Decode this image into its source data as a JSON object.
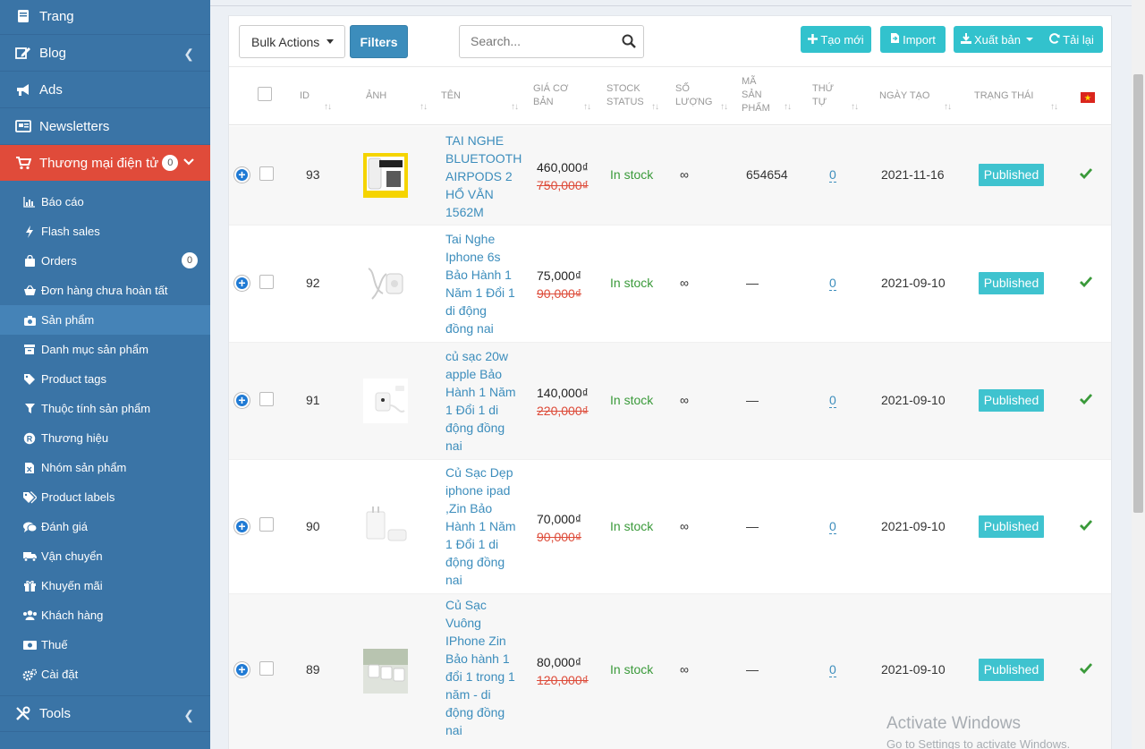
{
  "sidebar": {
    "top_items": [
      {
        "label": "Trang",
        "icon": "book-icon"
      },
      {
        "label": "Blog",
        "icon": "edit-icon",
        "has_chevron": true
      },
      {
        "label": "Ads",
        "icon": "bullhorn-icon"
      },
      {
        "label": "Newsletters",
        "icon": "newspaper-icon"
      }
    ],
    "active_item": {
      "label": "Thương mại điện tử",
      "badge": "0",
      "icon": "cart-icon"
    },
    "sub_items": [
      {
        "label": "Báo cáo",
        "icon": "bar-chart-icon"
      },
      {
        "label": "Flash sales",
        "icon": "bolt-icon"
      },
      {
        "label": "Orders",
        "icon": "shopping-bag-icon",
        "badge": "0"
      },
      {
        "label": "Đơn hàng chưa hoàn tất",
        "icon": "basket-icon"
      },
      {
        "label": "Sản phẩm",
        "icon": "camera-icon",
        "active": true
      },
      {
        "label": "Danh mục sản phẩm",
        "icon": "archive-icon"
      },
      {
        "label": "Product tags",
        "icon": "tag-icon"
      },
      {
        "label": "Thuộc tính sản phẩm",
        "icon": "filter-icon"
      },
      {
        "label": "Thương hiệu",
        "icon": "registered-icon"
      },
      {
        "label": "Nhóm sản phẩm",
        "icon": "excel-file-icon"
      },
      {
        "label": "Product labels",
        "icon": "tags-icon"
      },
      {
        "label": "Đánh giá",
        "icon": "comments-icon"
      },
      {
        "label": "Vận chuyển",
        "icon": "truck-icon"
      },
      {
        "label": "Khuyến mãi",
        "icon": "gift-icon"
      },
      {
        "label": "Khách hàng",
        "icon": "users-icon"
      },
      {
        "label": "Thuế",
        "icon": "money-icon"
      },
      {
        "label": "Cài đặt",
        "icon": "cogs-icon"
      }
    ],
    "bottom_item": {
      "label": "Tools",
      "icon": "tools-icon"
    }
  },
  "toolbar": {
    "bulk_actions": "Bulk Actions",
    "filters": "Filters",
    "search_placeholder": "Search...",
    "create": "Tạo mới",
    "import": "Import",
    "export": "Xuất bản",
    "reload": "Tải lại"
  },
  "table": {
    "headers": {
      "id": "ID",
      "image": "ẢNH",
      "name": "TÊN",
      "base_price": [
        "GIÁ CƠ",
        "BẢN"
      ],
      "stock_status": [
        "STOCK",
        "STATUS"
      ],
      "quantity": [
        "SỐ",
        "LƯỢNG"
      ],
      "sku": [
        "MÃ",
        "SẢN",
        "PHẨM"
      ],
      "order": [
        "THỨ",
        "TỰ"
      ],
      "created": "NGÀY TẠO",
      "status": "TRẠNG THÁI",
      "language_flag": "vietnam-flag-icon"
    },
    "rows": [
      {
        "id": "93",
        "name": [
          "TAI NGHE",
          "BLUETOOTH",
          "AIRPODS 2",
          "HỔ VẰN",
          "1562M"
        ],
        "price": "460,000₫",
        "old_price": "750,000₫",
        "stock": "In stock",
        "quantity": "∞",
        "sku": "654654",
        "order": "0",
        "created": "2021-11-16",
        "status": "Published"
      },
      {
        "id": "92",
        "name": [
          "Tai Nghe",
          "Iphone 6s",
          "Bảo Hành 1",
          "Năm 1 Đổi 1",
          "di động",
          "đồng nai"
        ],
        "price": "75,000₫",
        "old_price": "90,000₫",
        "stock": "In stock",
        "quantity": "∞",
        "sku": "—",
        "order": "0",
        "created": "2021-09-10",
        "status": "Published"
      },
      {
        "id": "91",
        "name": [
          "củ sạc 20w",
          "apple Bảo",
          "Hành 1 Năm",
          "1 Đổi 1 di",
          "động đồng",
          "nai"
        ],
        "price": "140,000₫",
        "old_price": "220,000₫",
        "stock": "In stock",
        "quantity": "∞",
        "sku": "—",
        "order": "0",
        "created": "2021-09-10",
        "status": "Published"
      },
      {
        "id": "90",
        "name": [
          "Củ Sạc Dẹp",
          "iphone ipad",
          ",Zin Bảo",
          "Hành 1 Năm",
          "1 Đổi 1 di",
          "động đồng",
          "nai"
        ],
        "price": "70,000₫",
        "old_price": "90,000₫",
        "stock": "In stock",
        "quantity": "∞",
        "sku": "—",
        "order": "0",
        "created": "2021-09-10",
        "status": "Published"
      },
      {
        "id": "89",
        "name": [
          "Củ Sạc",
          "Vuông",
          "IPhone Zin",
          "Bảo hành 1",
          "đổi 1 trong 1",
          "năm - di",
          "động đồng",
          "nai"
        ],
        "price": "80,000₫",
        "old_price": "120,000₫",
        "stock": "In stock",
        "quantity": "∞",
        "sku": "—",
        "order": "0",
        "created": "2021-09-10",
        "status": "Published"
      }
    ]
  },
  "watermark": {
    "line1": "Activate Windows",
    "line2": "Go to Settings to activate Windows."
  },
  "colors": {
    "sidebar": "#3a74a6",
    "active_menu": "#e04b3a",
    "accent": "#3c8dbc",
    "published": "#3fc3cf",
    "in_stock": "#3a9a3a",
    "old_price": "#dd4b39"
  }
}
